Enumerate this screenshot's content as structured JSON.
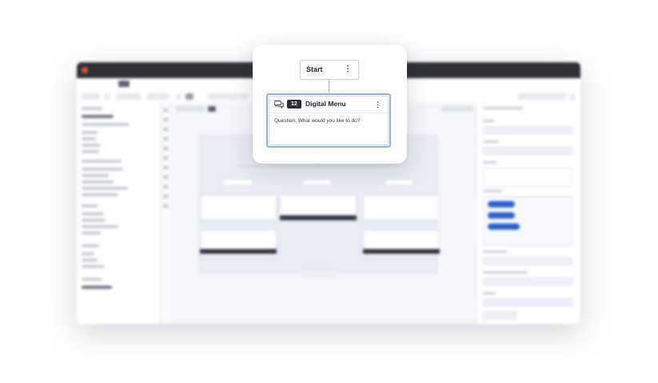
{
  "focus_card": {
    "start_node": {
      "label": "Start",
      "menu_icon": "kebab-icon"
    },
    "menu_node": {
      "icon": "chat-bubbles-icon",
      "id_badge": "12",
      "title": "Digital Menu",
      "menu_icon": "kebab-icon",
      "question": "Question: What would you like to do?"
    }
  },
  "colors": {
    "titlebar": "#2f3136",
    "accent_blue": "#2e62c9",
    "node_selected_border": "#8fb0ea",
    "badge_dark": "#2a2e38"
  }
}
